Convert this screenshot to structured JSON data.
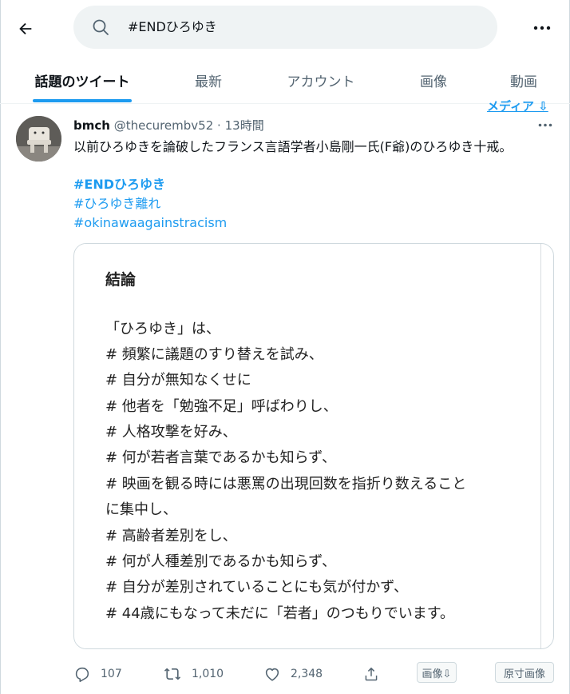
{
  "search": {
    "query": "#ENDひろゆき"
  },
  "tabs": [
    {
      "label": "話題のツイート",
      "active": true
    },
    {
      "label": "最新"
    },
    {
      "label": "アカウント"
    },
    {
      "label": "画像"
    },
    {
      "label": "動画"
    }
  ],
  "media_link": "メディア ⇩",
  "tweet": {
    "name": "bmch",
    "handle": "@thecurembv52",
    "separator": "·",
    "time": "13時間",
    "text": "以前ひろゆきを論破したフランス言語学者小島剛一氏(F爺)のひろゆき十戒。",
    "hashtags": [
      "#ENDひろゆき",
      "#ひろゆき離れ",
      "#okinawaagainstracism"
    ],
    "image": {
      "title": "結論",
      "lines": [
        "「ひろゆき」は、",
        "# 頻繁に議題のすり替えを試み、",
        "# 自分が無知なくせに",
        "# 他者を「勉強不足」呼ばわりし、",
        "# 人格攻撃を好み、",
        "# 何が若者言葉であるかも知らず、",
        "# 映画を観る時には悪罵の出現回数を指折り数えること",
        "に集中し、",
        "# 高齢者差別をし、",
        "# 何が人種差別であるかも知らず、",
        "# 自分が差別されていることにも気が付かず、",
        "# 44歳にもなって未だに「若者」のつもりでいます。"
      ]
    },
    "stats": {
      "replies": "107",
      "retweets": "1,010",
      "likes": "2,348"
    },
    "image_button": "画像⇩",
    "original_image_button": "原寸画像"
  }
}
